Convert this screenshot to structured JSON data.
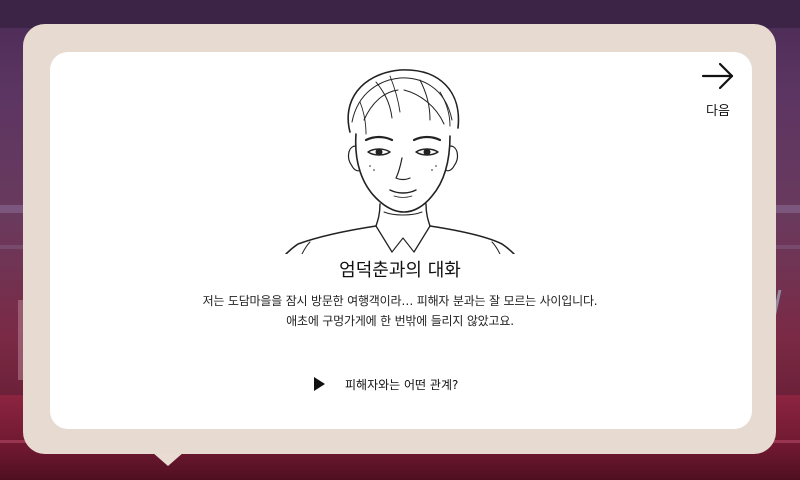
{
  "navigation": {
    "next_label": "다음",
    "next_icon": "arrow-right-icon"
  },
  "dialog": {
    "title": "엄덕춘과의 대화",
    "lines": [
      "저는 도담마을을 잠시 방문한 여행객이라… 피해자 분과는 잘 모르는 사이입니다.",
      "애초에 구멍가게에 한 번밖에 들리지 않았고요."
    ]
  },
  "choices": [
    {
      "icon": "play-icon",
      "label": "피해자와는 어떤 관계?"
    }
  ],
  "colors": {
    "panel_outer": "#e7dbd1",
    "panel_inner": "#ffffff",
    "text": "#111111",
    "background_top": "#4a2a55",
    "background_bottom": "#7a2a45"
  }
}
